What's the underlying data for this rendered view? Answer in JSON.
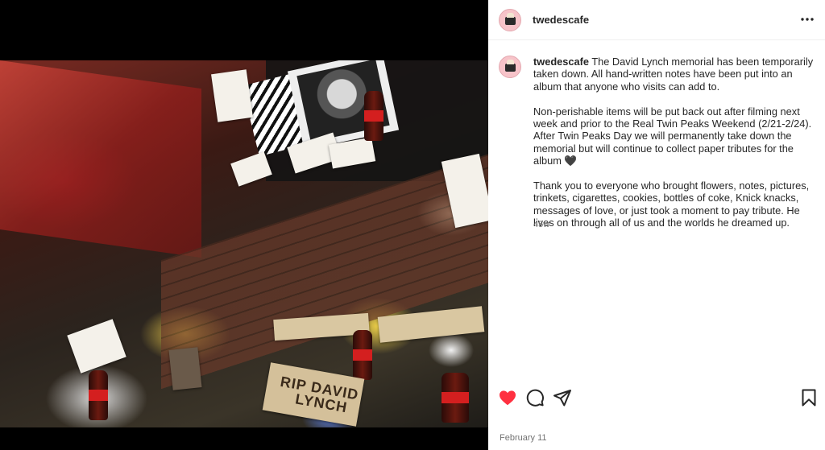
{
  "post": {
    "username": "twedescafe",
    "more_icon": "more-horizontal-icon",
    "caption_paragraphs": [
      "The David Lynch memorial has been temporarily taken down. All hand-written notes have been put into an album that anyone who visits can add to.",
      "Non-perishable items will be put back out after filming next week and prior to the Real Twin Peaks Weekend (2/21-2/24). After Twin Peaks Day we will permanently take down the memorial but will continue to collect paper tributes for the album 🖤",
      "Thank you to everyone who brought flowers, notes, pictures, trinkets, cigarettes, cookies, bottles of coke, Knick knacks, messages of love, or just took a moment to pay tribute. He lives on through all of us and the worlds he dreamed up."
    ],
    "time_ago": "45w",
    "date": "February 11",
    "liked": true,
    "like_color": "#ff3040"
  },
  "photo": {
    "sign_text_line1": "RIP DAVID",
    "sign_text_line2": "LYNCH"
  },
  "actions": {
    "like_icon": "heart-icon",
    "comment_icon": "comment-icon",
    "share_icon": "share-icon",
    "save_icon": "bookmark-icon"
  }
}
